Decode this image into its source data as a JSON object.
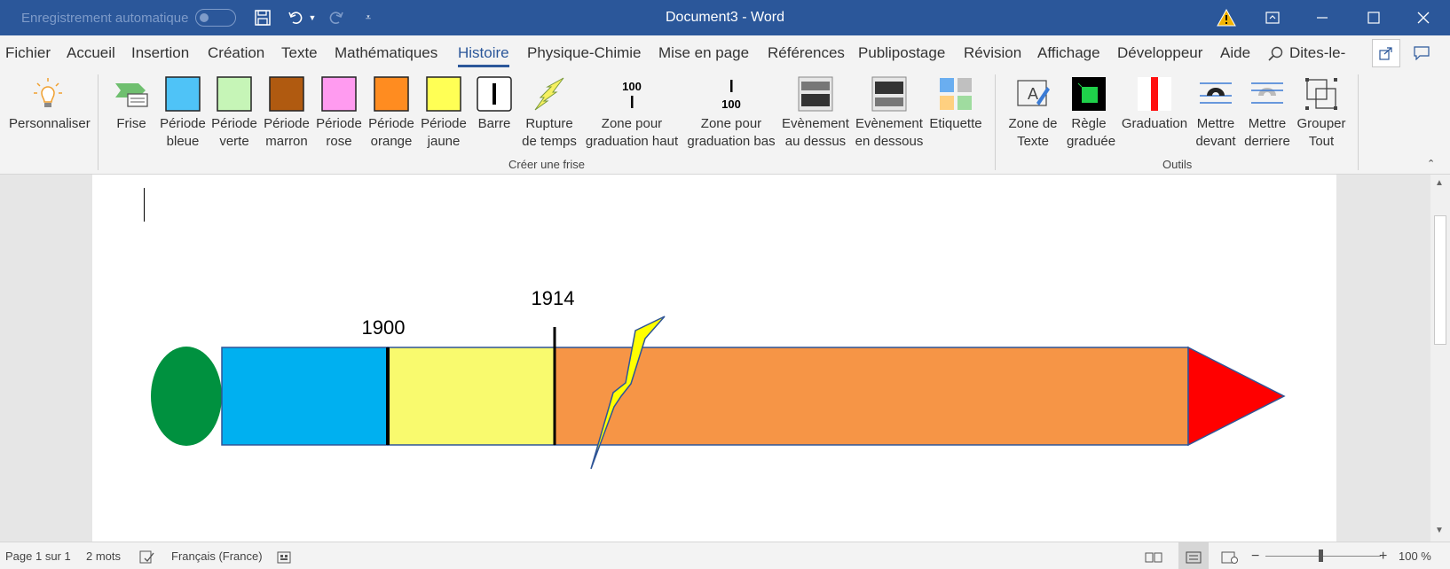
{
  "titlebar": {
    "autosave_label": "Enregistrement automatique",
    "document_title": "Document3  -  Word",
    "colors": {
      "bar": "#2b579a"
    }
  },
  "tabs": [
    {
      "label": "Fichier",
      "active": false
    },
    {
      "label": "Accueil",
      "active": false
    },
    {
      "label": "Insertion",
      "active": false
    },
    {
      "label": "Création",
      "active": false
    },
    {
      "label": "Texte",
      "active": false
    },
    {
      "label": "Mathématiques",
      "active": false
    },
    {
      "label": "Histoire",
      "active": true
    },
    {
      "label": "Physique-Chimie",
      "active": false
    },
    {
      "label": "Mise en page",
      "active": false
    },
    {
      "label": "Références",
      "active": false
    },
    {
      "label": "Publipostage",
      "active": false
    },
    {
      "label": "Révision",
      "active": false
    },
    {
      "label": "Affichage",
      "active": false
    },
    {
      "label": "Développeur",
      "active": false
    },
    {
      "label": "Aide",
      "active": false
    }
  ],
  "tell_me": "Dites-le-",
  "ribbon": {
    "personnaliser": {
      "line1": "Personnaliser",
      "line2": ""
    },
    "creer_frise": {
      "group_label": "Créer une frise",
      "buttons": [
        {
          "line1": "Frise",
          "line2": ""
        },
        {
          "line1": "Période",
          "line2": "bleue",
          "color": "#4fc3f7"
        },
        {
          "line1": "Période",
          "line2": "verte",
          "color": "#c6f5b7"
        },
        {
          "line1": "Période",
          "line2": "marron",
          "color": "#b05a10"
        },
        {
          "line1": "Période",
          "line2": "rose",
          "color": "#ff9bf0"
        },
        {
          "line1": "Période",
          "line2": "orange",
          "color": "#ff8c20"
        },
        {
          "line1": "Période",
          "line2": "jaune",
          "color": "#ffff55"
        },
        {
          "line1": "Barre",
          "line2": ""
        },
        {
          "line1": "Rupture",
          "line2": "de temps"
        },
        {
          "line1": "Zone pour",
          "line2": "graduation haut",
          "icon_text": "100"
        },
        {
          "line1": "Zone pour",
          "line2": "graduation bas",
          "icon_text": "100"
        },
        {
          "line1": "Evènement",
          "line2": "au dessus"
        },
        {
          "line1": "Evènement",
          "line2": "en dessous"
        },
        {
          "line1": "Etiquette",
          "line2": ""
        }
      ]
    },
    "outils": {
      "group_label": "Outils",
      "buttons": [
        {
          "line1": "Zone de",
          "line2": "Texte"
        },
        {
          "line1": "Règle",
          "line2": "graduée"
        },
        {
          "line1": "Graduation",
          "line2": ""
        },
        {
          "line1": "Mettre",
          "line2": "devant"
        },
        {
          "line1": "Mettre",
          "line2": "derriere"
        },
        {
          "line1": "Grouper",
          "line2": "Tout"
        }
      ]
    }
  },
  "timeline": {
    "labels": [
      "1900",
      "1914"
    ],
    "colors": {
      "eraser": "#00913f",
      "segment_blue": "#00b0f0",
      "segment_yellow": "#f9fa6e",
      "segment_orange": "#f69546",
      "tip": "#ff0000",
      "lightning": "#ffff00"
    }
  },
  "status": {
    "page": "Page 1 sur 1",
    "words": "2 mots",
    "language": "Français (France)",
    "zoom": "100 %"
  }
}
